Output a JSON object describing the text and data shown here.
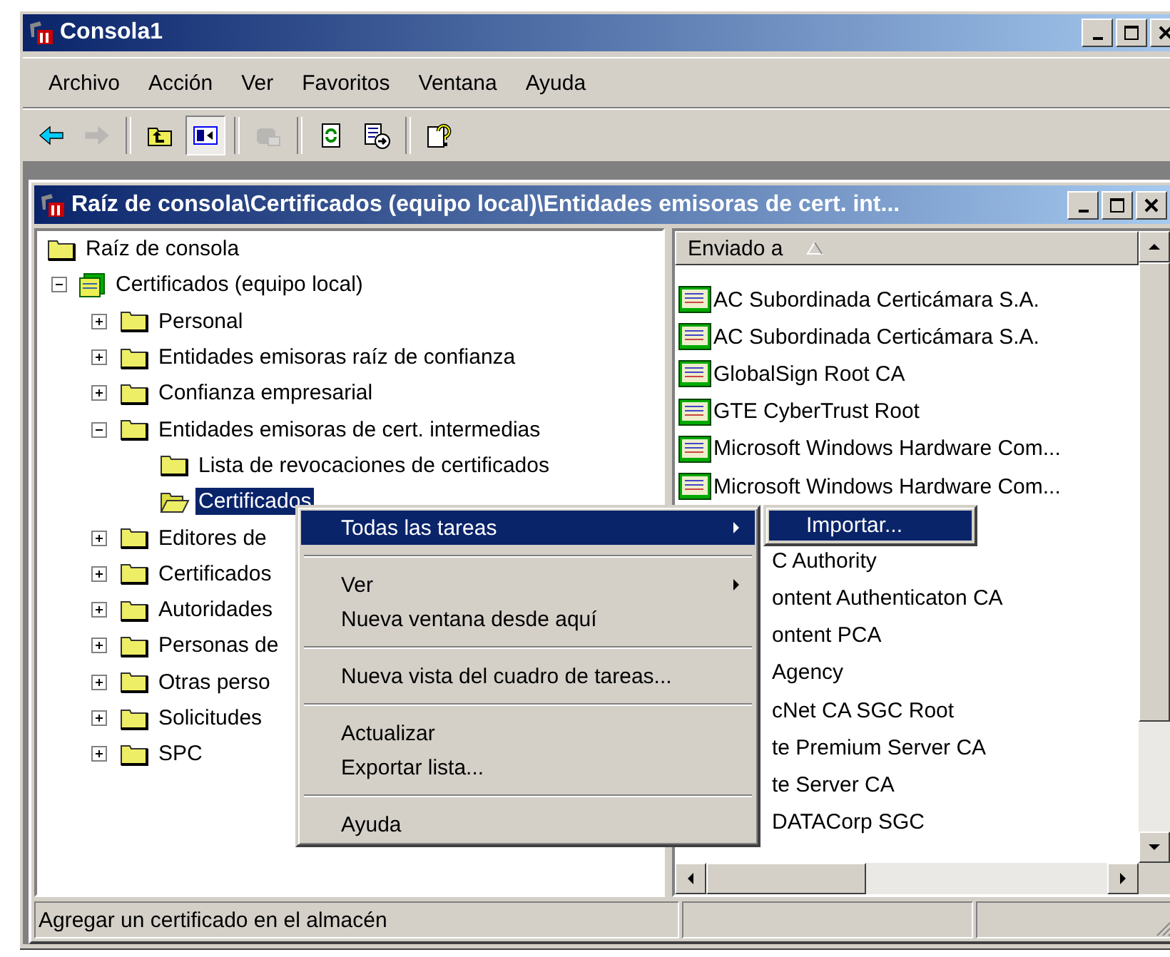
{
  "window": {
    "title": "Consola1"
  },
  "menu_bar": [
    "Archivo",
    "Acción",
    "Ver",
    "Favoritos",
    "Ventana",
    "Ayuda"
  ],
  "toolbar": [
    {
      "kind": "back",
      "disabled": false,
      "pressed": false
    },
    {
      "kind": "forward",
      "disabled": true,
      "pressed": false
    },
    {
      "kind": "separator"
    },
    {
      "kind": "up",
      "disabled": false,
      "pressed": false
    },
    {
      "kind": "tree",
      "disabled": false,
      "pressed": true
    },
    {
      "kind": "separator"
    },
    {
      "kind": "delete",
      "disabled": true,
      "pressed": false
    },
    {
      "kind": "separator"
    },
    {
      "kind": "refresh",
      "disabled": false,
      "pressed": false
    },
    {
      "kind": "export",
      "disabled": false,
      "pressed": false
    },
    {
      "kind": "separator"
    },
    {
      "kind": "help",
      "disabled": false,
      "pressed": false
    }
  ],
  "child_window": {
    "title": "Raíz de consola\\Certificados (equipo local)\\Entidades emisoras de cert. int..."
  },
  "tree": [
    {
      "label": "Raíz de consola",
      "kind": "folder",
      "selected": false,
      "children": [
        {
          "label": "Certificados (equipo local)",
          "kind": "store",
          "selected": false,
          "expanded": true,
          "children": [
            {
              "label": "Personal",
              "kind": "folder",
              "selected": false,
              "expanded": false
            },
            {
              "label": "Entidades emisoras raíz de confianza",
              "kind": "folder",
              "selected": false,
              "expanded": false
            },
            {
              "label": "Confianza empresarial",
              "kind": "folder",
              "selected": false,
              "expanded": false
            },
            {
              "label": "Entidades emisoras de cert. intermedias",
              "kind": "folder",
              "selected": false,
              "expanded": true,
              "children": [
                {
                  "label": "Lista de revocaciones de certificados",
                  "kind": "folder",
                  "selected": false
                },
                {
                  "label": "Certificados",
                  "kind": "folder",
                  "selected": true
                }
              ]
            },
            {
              "label": "Editores de",
              "kind": "folder",
              "selected": false,
              "expanded": false
            },
            {
              "label": "Certificados",
              "kind": "folder",
              "selected": false,
              "expanded": false
            },
            {
              "label": "Autoridades",
              "kind": "folder",
              "selected": false,
              "expanded": false
            },
            {
              "label": "Personas de",
              "kind": "folder",
              "selected": false,
              "expanded": false
            },
            {
              "label": "Otras perso",
              "kind": "folder",
              "selected": false,
              "expanded": false
            },
            {
              "label": "Solicitudes",
              "kind": "folder",
              "selected": false,
              "expanded": false
            },
            {
              "label": "SPC",
              "kind": "folder",
              "selected": false,
              "expanded": false
            }
          ]
        }
      ]
    }
  ],
  "list": {
    "columns": [
      {
        "label": "Enviado a"
      }
    ],
    "rows": [
      {
        "kind": "certificate",
        "text": "AC Subordinada Certicámara S.A."
      },
      {
        "kind": "certificate",
        "text": "AC Subordinada Certicámara S.A."
      },
      {
        "kind": "certificate",
        "text": "GlobalSign Root CA"
      },
      {
        "kind": "certificate",
        "text": "GTE CyberTrust Root"
      },
      {
        "kind": "certificate",
        "text": "Microsoft Windows Hardware Com..."
      },
      {
        "kind": "certificate",
        "text": "Microsoft Windows Hardware Com..."
      },
      {
        "kind": "hidden"
      },
      {
        "kind": "clipped",
        "text": "C Authority"
      },
      {
        "kind": "clipped",
        "text": "ontent Authenticaton CA"
      },
      {
        "kind": "clipped",
        "text": "ontent PCA"
      },
      {
        "kind": "clipped",
        "text": "Agency"
      },
      {
        "kind": "clipped",
        "text": "cNet CA SGC Root"
      },
      {
        "kind": "clipped",
        "text": "te Premium Server CA"
      },
      {
        "kind": "clipped",
        "text": "te Server CA"
      },
      {
        "kind": "clipped",
        "text": "DATACorp SGC"
      }
    ]
  },
  "context_menu": [
    {
      "kind": "item",
      "label": "Todas las tareas",
      "submenu": true,
      "selected": true
    },
    {
      "kind": "separator"
    },
    {
      "kind": "item",
      "label": "Ver",
      "submenu": true,
      "selected": false
    },
    {
      "kind": "item",
      "label": "Nueva ventana desde aquí",
      "submenu": false,
      "selected": false
    },
    {
      "kind": "separator"
    },
    {
      "kind": "item",
      "label": "Nueva vista del cuadro de tareas...",
      "submenu": false,
      "selected": false
    },
    {
      "kind": "separator"
    },
    {
      "kind": "item",
      "label": "Actualizar",
      "submenu": false,
      "selected": false
    },
    {
      "kind": "item",
      "label": "Exportar lista...",
      "submenu": false,
      "selected": false
    },
    {
      "kind": "separator"
    },
    {
      "kind": "item",
      "label": "Ayuda",
      "submenu": false,
      "selected": false
    }
  ],
  "submenu": [
    {
      "label": "Importar...",
      "selected": true
    }
  ],
  "status_bar": {
    "text": "Agregar un certificado en el almacén"
  }
}
